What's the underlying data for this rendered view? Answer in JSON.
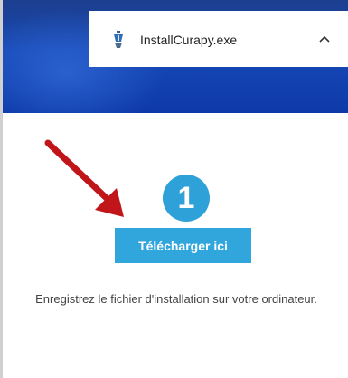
{
  "download_bar": {
    "file_name": "InstallCurapy.exe",
    "file_icon": "installer-icon",
    "chevron_icon": "chevron-up-icon"
  },
  "step": {
    "number": "1"
  },
  "download_button": {
    "label": "Télécharger ici"
  },
  "instruction": {
    "text": "Enregistrez le fichier d'installation sur votre ordinateur."
  },
  "colors": {
    "accent": "#2ea1d8",
    "arrow": "#c0161a",
    "desktop": "#1749b6"
  }
}
